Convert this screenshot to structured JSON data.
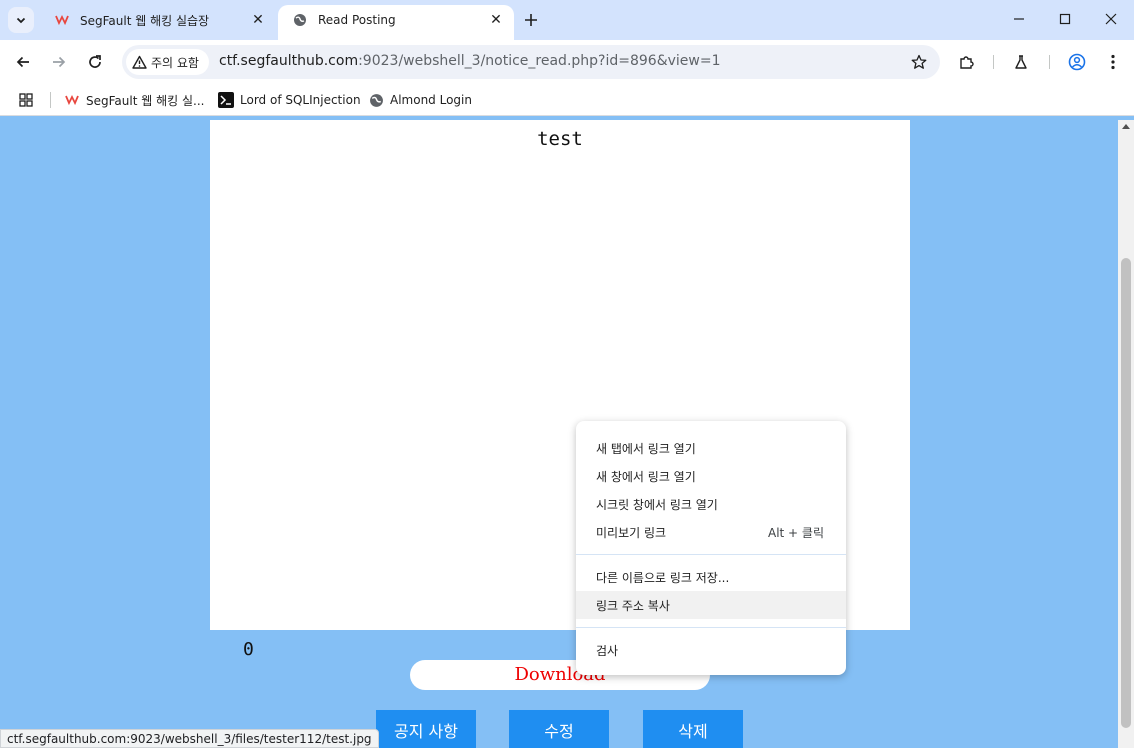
{
  "browser": {
    "tabs": [
      {
        "title": "SegFault 웹 해킹 실습장",
        "favicon": "segfault-icon",
        "active": false
      },
      {
        "title": "Read Posting",
        "favicon": "globe-icon",
        "active": true
      }
    ],
    "security_chip": "주의 요함",
    "url_host": "ctf.segfaulthub.com",
    "url_path": ":9023/webshell_3/notice_read.php?id=896&view=1",
    "bookmarks": [
      {
        "label": "SegFault 웹 해킹 실...",
        "icon": "segfault-icon"
      },
      {
        "label": "Lord of SQLInjection",
        "icon": "terminal-icon"
      },
      {
        "label": "Almond Login",
        "icon": "globe-icon"
      }
    ]
  },
  "page": {
    "post_title": "test",
    "counter": "0",
    "download_label": "Download",
    "buttons": {
      "notice": "공지 사항",
      "edit": "수정",
      "delete": "삭제"
    }
  },
  "context_menu": {
    "items": [
      {
        "label": "새 탭에서 링크 열기"
      },
      {
        "label": "새 창에서 링크 열기"
      },
      {
        "label": "시크릿 창에서 링크 열기"
      },
      {
        "label": "미리보기 링크",
        "shortcut": "Alt + 클릭"
      },
      {
        "label": "다른 이름으로 링크 저장..."
      },
      {
        "label": "링크 주소 복사",
        "hovered": true
      },
      {
        "label": "검사"
      }
    ]
  },
  "status_bar": "ctf.segfaulthub.com:9023/webshell_3/files/tester112/test.jpg",
  "colors": {
    "page_background": "#84bff5",
    "action_button": "#1f8ef1",
    "download_text": "#ee0000",
    "tabbar": "#d3e3fd"
  }
}
